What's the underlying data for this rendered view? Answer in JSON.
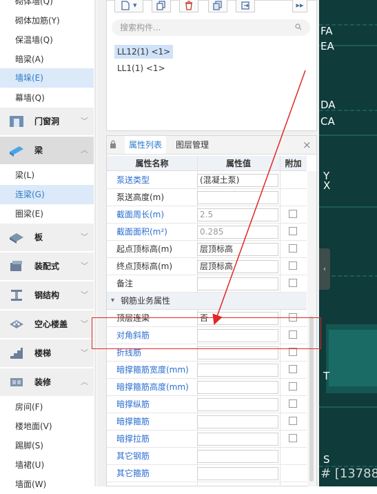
{
  "left_nav": {
    "items_top": [
      {
        "label": "砌体墙(Q)"
      },
      {
        "label": "砌体加筋(Y)"
      },
      {
        "label": "保温墙(Q)"
      },
      {
        "label": "暗梁(A)"
      },
      {
        "label": "墙垛(E)",
        "active": true
      },
      {
        "label": "幕墙(Q)"
      }
    ],
    "groups": [
      {
        "label": "门窗洞",
        "icon": "door-window-icon",
        "chevron": "﹀"
      },
      {
        "label": "梁",
        "icon": "beam-icon",
        "chevron": "︿",
        "active": true
      }
    ],
    "beam_items": [
      {
        "label": "梁(L)"
      },
      {
        "label": "连梁(G)",
        "active": true
      },
      {
        "label": "圈梁(E)"
      }
    ],
    "groups2": [
      {
        "label": "板",
        "icon": "slab-icon",
        "chevron": "﹀"
      },
      {
        "label": "装配式",
        "icon": "prefab-icon",
        "chevron": "﹀"
      },
      {
        "label": "钢结构",
        "icon": "steel-structure-icon",
        "chevron": "﹀"
      },
      {
        "label": "空心楼盖",
        "icon": "hollow-floor-icon",
        "chevron": "﹀"
      },
      {
        "label": "楼梯",
        "icon": "stairs-icon",
        "chevron": "﹀"
      },
      {
        "label": "装修",
        "icon": "decoration-icon",
        "chevron": "︿"
      }
    ],
    "decor_items": [
      {
        "label": "房间(F)"
      },
      {
        "label": "楼地面(V)"
      },
      {
        "label": "踢脚(S)"
      },
      {
        "label": "墙裙(U)"
      },
      {
        "label": "墙面(W)"
      }
    ]
  },
  "toolbar": {
    "expand_label": "▸▸",
    "dropdown_arrow": "▾"
  },
  "search": {
    "placeholder": "搜索构件..."
  },
  "components": [
    {
      "label": "LL12(1) <1>",
      "selected": true
    },
    {
      "label": "LL1(1) <1>"
    }
  ],
  "tabs": {
    "properties": "属性列表",
    "layers": "图层管理",
    "close": "×"
  },
  "table": {
    "headers": {
      "name": "属性名称",
      "value": "属性值",
      "extra": "附加"
    },
    "rows": [
      {
        "name": "泵送类型",
        "value": "(混凝土泵)",
        "blue": true
      },
      {
        "name": "泵送高度(m)",
        "value": ""
      },
      {
        "name": "截面周长(m)",
        "value": "2.5",
        "blue": true,
        "disabled": true
      },
      {
        "name": "截面面积(m²)",
        "value": "0.285",
        "blue": true,
        "disabled": true
      },
      {
        "name": "起点顶标高(m)",
        "value": "层顶标高"
      },
      {
        "name": "终点顶标高(m)",
        "value": "层顶标高"
      },
      {
        "name": "备注",
        "value": ""
      }
    ],
    "group_label": "钢筋业务属性",
    "group_toggle": "▾",
    "rows2": [
      {
        "name": "顶层连梁",
        "value": "否"
      },
      {
        "name": "对角斜筋",
        "value": "",
        "blue": true
      },
      {
        "name": "折线筋",
        "value": "",
        "blue": true
      },
      {
        "name": "暗撑箍筋宽度(mm)",
        "value": "",
        "blue": true
      },
      {
        "name": "暗撑箍筋高度(mm)",
        "value": "",
        "blue": true
      },
      {
        "name": "暗撑纵筋",
        "value": "",
        "blue": true
      },
      {
        "name": "暗撑箍筋",
        "value": "",
        "blue": true
      },
      {
        "name": "暗撑拉筋",
        "value": "",
        "blue": true
      },
      {
        "name": "其它钢筋",
        "value": "",
        "blue": true
      },
      {
        "name": "其它箍筋",
        "value": "",
        "blue": true
      }
    ]
  },
  "canvas": {
    "labels": [
      "FA",
      "EA",
      "DA",
      "CA",
      "Y",
      "X",
      "T",
      "S"
    ],
    "coord_text": "# [13788"
  },
  "colors": {
    "accent": "#2b79c9",
    "highlight": "#e02626",
    "canvas_bg": "#0f3b3a"
  }
}
